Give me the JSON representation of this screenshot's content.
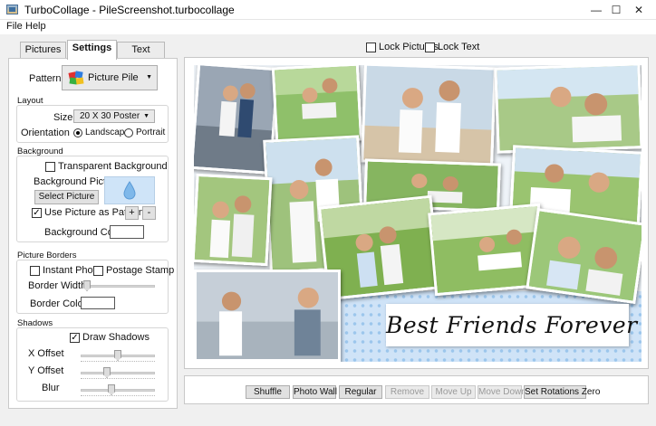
{
  "window": {
    "title": "TurboCollage - PileScreenshot.turbocollage",
    "controls": {
      "minimize": "—",
      "maximize": "☐",
      "close": "✕"
    }
  },
  "menu": {
    "file": "File",
    "help": "Help"
  },
  "tabs": [
    "Pictures",
    "Settings",
    "Text"
  ],
  "settings": {
    "pattern_label": "Pattern",
    "pattern_value": "Picture Pile",
    "layout": {
      "group_label": "Layout",
      "size_label": "Size",
      "size_value": "20 X 30 Poster",
      "orientation_label": "Orientation",
      "landscape": "Landscape",
      "portrait": "Portrait",
      "orientation_selected": "Landscape"
    },
    "background": {
      "group_label": "Background",
      "transparent_label": "Transparent Background",
      "transparent_checked": false,
      "picture_label": "Background Picture",
      "select_picture": "Select Picture",
      "use_pattern_label": "Use Picture as Pattern",
      "use_pattern_checked": true,
      "plus": "+",
      "minus": "-",
      "color_label": "Background Color",
      "color_value": "#ffffff"
    },
    "borders": {
      "group_label": "Picture Borders",
      "instant_photo": "Instant Photo",
      "instant_photo_checked": false,
      "postage_stamp": "Postage Stamp",
      "postage_stamp_checked": false,
      "width_label": "Border Width",
      "width_level": 0.0,
      "color_label": "Border Color",
      "color_value": "#ffffff"
    },
    "shadows": {
      "group_label": "Shadows",
      "draw_label": "Draw Shadows",
      "draw_checked": true,
      "x_offset_label": "X Offset",
      "x_offset_level": 0.5,
      "y_offset_label": "Y Offset",
      "y_offset_level": 0.35,
      "blur_label": "Blur",
      "blur_level": 0.4
    }
  },
  "top_options": {
    "lock_pictures": "Lock Pictures",
    "lock_text": "Lock Text"
  },
  "canvas": {
    "caption": "Best Friends Forever"
  },
  "buttons": {
    "shuffle": "Shuffle",
    "photo_wall": "Photo Wall",
    "regular": "Regular",
    "remove": "Remove",
    "move_up": "Move Up",
    "move_down": "Move Down",
    "set_rotations_zero": "Set Rotations Zero"
  },
  "icons": {
    "app": "turbocollage-app-icon",
    "pattern": "picture-pile-icon",
    "background_preview": "water-drop-icon"
  }
}
